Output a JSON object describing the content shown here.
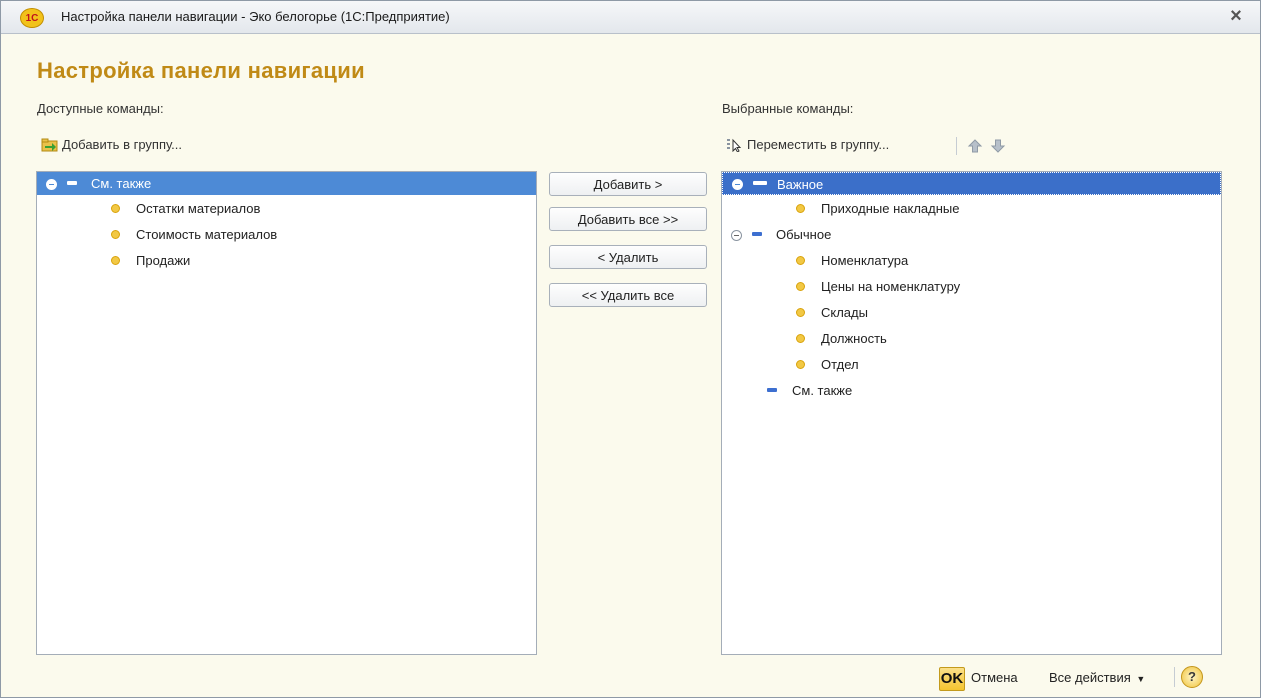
{
  "window": {
    "title": "Настройка панели навигации - Эко белогорье  (1С:Предприятие)",
    "logo_text": "1С",
    "close_glyph": "×"
  },
  "heading": "Настройка панели навигации",
  "left": {
    "label": "Доступные команды:",
    "tool_add_group": "Добавить в группу...",
    "tree": {
      "group": "См. также",
      "items": [
        "Остатки материалов",
        "Стоимость материалов",
        "Продажи"
      ]
    }
  },
  "middle": {
    "add": "Добавить >",
    "add_all": "Добавить все >>",
    "remove": "< Удалить",
    "remove_all": "<< Удалить все"
  },
  "right": {
    "label": "Выбранные команды:",
    "tool_move_group": "Переместить в группу...",
    "tree": {
      "important": {
        "label": "Важное",
        "items": [
          "Приходные накладные"
        ]
      },
      "normal": {
        "label": "Обычное",
        "items": [
          "Номенклатура",
          "Цены на номенклатуру",
          "Склады",
          "Должность",
          "Отдел"
        ]
      },
      "see_also": {
        "label": "См. также"
      }
    }
  },
  "footer": {
    "ok": "OK",
    "cancel": "Отмена",
    "all_actions": "Все действия",
    "help": "?"
  },
  "colors": {
    "selection": "#4d8ad6",
    "heading": "#c08a16",
    "background": "#fbfaed"
  }
}
